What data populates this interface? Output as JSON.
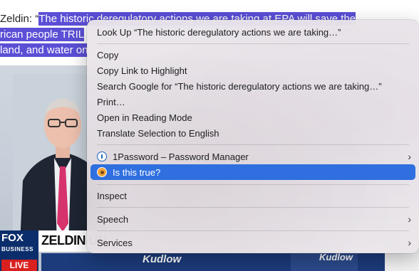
{
  "article": {
    "line1_prefix": "Zeldin: “",
    "line1_selected": "The historic deregulatory actions we are taking at EPA will save the",
    "line2_selected": "rican people TRIL",
    "line3_selected": "land, and water on"
  },
  "video": {
    "network_logo": "FOX",
    "network_sub": "BUSINESS",
    "live_label": "LIVE",
    "headline": "ZELDIN UN",
    "show_name": "Kudlow",
    "inset_show_name": "Kudlow"
  },
  "context_menu": {
    "look_up": "Look Up “The historic deregulatory actions we are taking…”",
    "copy": "Copy",
    "copy_link": "Copy Link to Highlight",
    "search_google": "Search Google for “The historic deregulatory actions we are taking…”",
    "print": "Print…",
    "reading_mode": "Open in Reading Mode",
    "translate": "Translate Selection to English",
    "password_manager": "1Password – Password Manager",
    "is_this_true": "Is this true?",
    "inspect": "Inspect",
    "speech": "Speech",
    "services": "Services",
    "submenu_chevron": "›"
  },
  "colors": {
    "selection": "#5b4fd6",
    "menu_highlight": "#2f6fdf"
  }
}
